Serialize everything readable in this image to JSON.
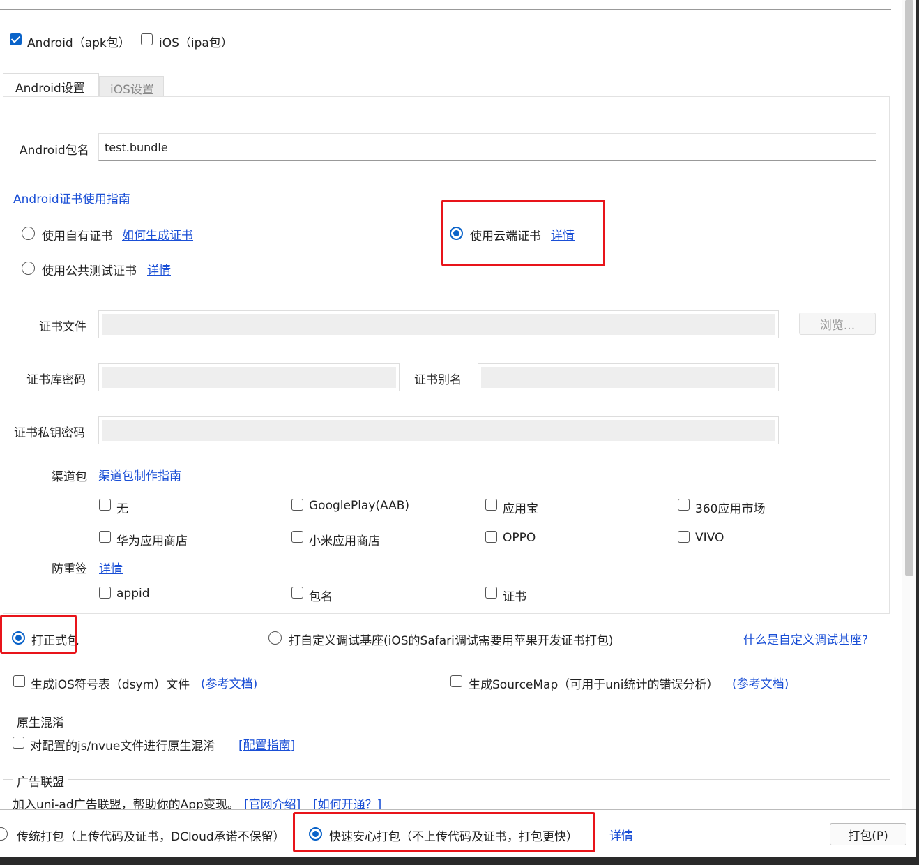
{
  "platforms": {
    "android_label": "Android（apk包）",
    "android_checked": true,
    "ios_label": "iOS（ipa包）",
    "ios_checked": false
  },
  "tabs": [
    {
      "label": "Android设置",
      "active": true
    },
    {
      "label": "iOS设置",
      "active": false
    }
  ],
  "android": {
    "package_label": "Android包名",
    "package_value": "test.bundle",
    "cert_guide_link": "Android证书使用指南",
    "cert_options": {
      "own_label": "使用自有证书",
      "own_link": "如何生成证书",
      "public_label": "使用公共测试证书",
      "public_link": "详情",
      "cloud_label": "使用云端证书",
      "cloud_link": "详情",
      "selected": "cloud"
    },
    "cert_file_label": "证书文件",
    "browse_button": "浏览...",
    "keystore_pwd_label": "证书库密码",
    "alias_label": "证书别名",
    "key_pwd_label": "证书私钥密码",
    "channel_label": "渠道包",
    "channel_guide_link": "渠道包制作指南",
    "channels": [
      {
        "label": "无",
        "checked": false
      },
      {
        "label": "GooglePlay(AAB)",
        "checked": false
      },
      {
        "label": "应用宝",
        "checked": false
      },
      {
        "label": "360应用市场",
        "checked": false
      },
      {
        "label": "华为应用商店",
        "checked": false
      },
      {
        "label": "小米应用商店",
        "checked": false
      },
      {
        "label": "OPPO",
        "checked": false
      },
      {
        "label": "VIVO",
        "checked": false
      }
    ],
    "anti_resign_label": "防重签",
    "anti_resign_link": "详情",
    "anti_resign_options": [
      {
        "label": "appid",
        "checked": false
      },
      {
        "label": "包名",
        "checked": false
      },
      {
        "label": "证书",
        "checked": false
      }
    ]
  },
  "build_type": {
    "release_label": "打正式包",
    "custom_base_label": "打自定义调试基座(iOS的Safari调试需要用苹果开发证书打包)",
    "custom_base_link": "什么是自定义调试基座?",
    "selected": "release"
  },
  "options": {
    "dsym_label": "生成iOS符号表（dsym）文件",
    "dsym_link": "(参考文档)",
    "sourcemap_label": "生成SourceMap（可用于uni统计的错误分析）",
    "sourcemap_link": "(参考文档)"
  },
  "obfuscation": {
    "legend": "原生混淆",
    "label": "对配置的js/nvue文件进行原生混淆",
    "link": "[配置指南]"
  },
  "ad_alliance": {
    "legend": "广告联盟",
    "text": "加入uni-ad广告联盟，帮助你的App变现。",
    "link_official": "[官网介绍]",
    "link_how": "[如何开通？]"
  },
  "footer": {
    "traditional_label": "传统打包（上传代码及证书，DCloud承诺不保留）",
    "fast_label": "快速安心打包（不上传代码及证书，打包更快）",
    "detail_link": "详情",
    "pack_button": "打包(P)",
    "selected": "fast"
  },
  "colors": {
    "accent": "#0a63c9",
    "link": "#1a4fd6",
    "highlight": "#e8141a"
  }
}
